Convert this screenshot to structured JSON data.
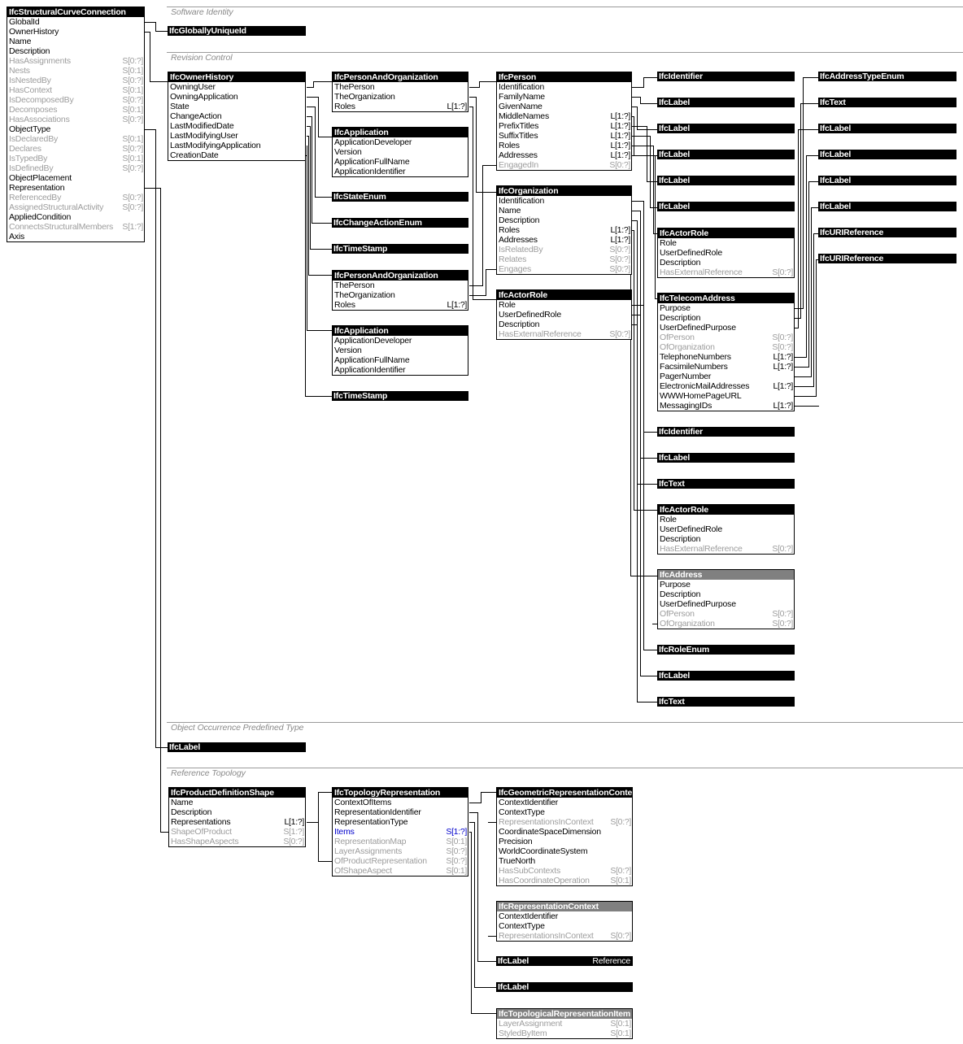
{
  "diagram": {
    "title": "IfcStructuralCurveConnection entity attribute diagram",
    "colors": {
      "header_concrete": "#000000",
      "header_abstract": "#808080",
      "inverse_attribute": "#9d9d9d",
      "highlight": "#0000cc",
      "separator": "#9a9a9a"
    }
  },
  "sections": [
    {
      "label": "Software Identity"
    },
    {
      "label": "Revision Control"
    },
    {
      "label": "Object Occurrence Predefined Type"
    },
    {
      "label": "Reference Topology"
    }
  ],
  "entities": {
    "root": {
      "name": "IfcStructuralCurveConnection",
      "abstract": false,
      "attributes": [
        {
          "name": "GlobalId",
          "card": "",
          "inverse": false
        },
        {
          "name": "OwnerHistory",
          "card": "",
          "inverse": false
        },
        {
          "name": "Name",
          "card": "",
          "inverse": false
        },
        {
          "name": "Description",
          "card": "",
          "inverse": false
        },
        {
          "name": "HasAssignments",
          "card": "S[0:?]",
          "inverse": true
        },
        {
          "name": "Nests",
          "card": "S[0:1]",
          "inverse": true
        },
        {
          "name": "IsNestedBy",
          "card": "S[0:?]",
          "inverse": true
        },
        {
          "name": "HasContext",
          "card": "S[0:1]",
          "inverse": true
        },
        {
          "name": "IsDecomposedBy",
          "card": "S[0:?]",
          "inverse": true
        },
        {
          "name": "Decomposes",
          "card": "S[0:1]",
          "inverse": true
        },
        {
          "name": "HasAssociations",
          "card": "S[0:?]",
          "inverse": true
        },
        {
          "name": "ObjectType",
          "card": "",
          "inverse": false
        },
        {
          "name": "IsDeclaredBy",
          "card": "S[0:1]",
          "inverse": true
        },
        {
          "name": "Declares",
          "card": "S[0:?]",
          "inverse": true
        },
        {
          "name": "IsTypedBy",
          "card": "S[0:1]",
          "inverse": true
        },
        {
          "name": "IsDefinedBy",
          "card": "S[0:?]",
          "inverse": true
        },
        {
          "name": "ObjectPlacement",
          "card": "",
          "inverse": false
        },
        {
          "name": "Representation",
          "card": "",
          "inverse": false
        },
        {
          "name": "ReferencedBy",
          "card": "S[0:?]",
          "inverse": true
        },
        {
          "name": "AssignedStructuralActivity",
          "card": "S[0:?]",
          "inverse": true
        },
        {
          "name": "AppliedCondition",
          "card": "",
          "inverse": false
        },
        {
          "name": "ConnectsStructuralMembers",
          "card": "S[1:?]",
          "inverse": true
        },
        {
          "name": "Axis",
          "card": "",
          "inverse": false
        }
      ]
    },
    "owner_history": {
      "name": "IfcOwnerHistory",
      "abstract": false,
      "attributes": [
        {
          "name": "OwningUser",
          "card": "",
          "inverse": false
        },
        {
          "name": "OwningApplication",
          "card": "",
          "inverse": false
        },
        {
          "name": "State",
          "card": "",
          "inverse": false
        },
        {
          "name": "ChangeAction",
          "card": "",
          "inverse": false
        },
        {
          "name": "LastModifiedDate",
          "card": "",
          "inverse": false
        },
        {
          "name": "LastModifyingUser",
          "card": "",
          "inverse": false
        },
        {
          "name": "LastModifyingApplication",
          "card": "",
          "inverse": false
        },
        {
          "name": "CreationDate",
          "card": "",
          "inverse": false
        }
      ]
    },
    "person_and_org_1": {
      "name": "IfcPersonAndOrganization",
      "abstract": false,
      "attributes": [
        {
          "name": "ThePerson",
          "card": "",
          "inverse": false
        },
        {
          "name": "TheOrganization",
          "card": "",
          "inverse": false
        },
        {
          "name": "Roles",
          "card": "L[1:?]",
          "inverse": false
        }
      ]
    },
    "application_1": {
      "name": "IfcApplication",
      "abstract": false,
      "attributes": [
        {
          "name": "ApplicationDeveloper",
          "card": "",
          "inverse": false
        },
        {
          "name": "Version",
          "card": "",
          "inverse": false
        },
        {
          "name": "ApplicationFullName",
          "card": "",
          "inverse": false
        },
        {
          "name": "ApplicationIdentifier",
          "card": "",
          "inverse": false
        }
      ]
    },
    "person_and_org_2": {
      "name": "IfcPersonAndOrganization",
      "abstract": false,
      "attributes": [
        {
          "name": "ThePerson",
          "card": "",
          "inverse": false
        },
        {
          "name": "TheOrganization",
          "card": "",
          "inverse": false
        },
        {
          "name": "Roles",
          "card": "L[1:?]",
          "inverse": false
        }
      ]
    },
    "application_2": {
      "name": "IfcApplication",
      "abstract": false,
      "attributes": [
        {
          "name": "ApplicationDeveloper",
          "card": "",
          "inverse": false
        },
        {
          "name": "Version",
          "card": "",
          "inverse": false
        },
        {
          "name": "ApplicationFullName",
          "card": "",
          "inverse": false
        },
        {
          "name": "ApplicationIdentifier",
          "card": "",
          "inverse": false
        }
      ]
    },
    "person": {
      "name": "IfcPerson",
      "abstract": false,
      "attributes": [
        {
          "name": "Identification",
          "card": "",
          "inverse": false
        },
        {
          "name": "FamilyName",
          "card": "",
          "inverse": false
        },
        {
          "name": "GivenName",
          "card": "",
          "inverse": false
        },
        {
          "name": "MiddleNames",
          "card": "L[1:?]",
          "inverse": false
        },
        {
          "name": "PrefixTitles",
          "card": "L[1:?]",
          "inverse": false
        },
        {
          "name": "SuffixTitles",
          "card": "L[1:?]",
          "inverse": false
        },
        {
          "name": "Roles",
          "card": "L[1:?]",
          "inverse": false
        },
        {
          "name": "Addresses",
          "card": "L[1:?]",
          "inverse": false
        },
        {
          "name": "EngagedIn",
          "card": "S[0:?]",
          "inverse": true
        }
      ]
    },
    "organization": {
      "name": "IfcOrganization",
      "abstract": false,
      "attributes": [
        {
          "name": "Identification",
          "card": "",
          "inverse": false
        },
        {
          "name": "Name",
          "card": "",
          "inverse": false
        },
        {
          "name": "Description",
          "card": "",
          "inverse": false
        },
        {
          "name": "Roles",
          "card": "L[1:?]",
          "inverse": false
        },
        {
          "name": "Addresses",
          "card": "L[1:?]",
          "inverse": false
        },
        {
          "name": "IsRelatedBy",
          "card": "S[0:?]",
          "inverse": true
        },
        {
          "name": "Relates",
          "card": "S[0:?]",
          "inverse": true
        },
        {
          "name": "Engages",
          "card": "S[0:?]",
          "inverse": true
        }
      ]
    },
    "actor_role_mid": {
      "name": "IfcActorRole",
      "abstract": false,
      "attributes": [
        {
          "name": "Role",
          "card": "",
          "inverse": false
        },
        {
          "name": "UserDefinedRole",
          "card": "",
          "inverse": false
        },
        {
          "name": "Description",
          "card": "",
          "inverse": false
        },
        {
          "name": "HasExternalReference",
          "card": "S[0:?]",
          "inverse": true
        }
      ]
    },
    "actor_role_r1": {
      "name": "IfcActorRole",
      "abstract": false,
      "attributes": [
        {
          "name": "Role",
          "card": "",
          "inverse": false
        },
        {
          "name": "UserDefinedRole",
          "card": "",
          "inverse": false
        },
        {
          "name": "Description",
          "card": "",
          "inverse": false
        },
        {
          "name": "HasExternalReference",
          "card": "S[0:?]",
          "inverse": true
        }
      ]
    },
    "telecom_address": {
      "name": "IfcTelecomAddress",
      "abstract": false,
      "attributes": [
        {
          "name": "Purpose",
          "card": "",
          "inverse": false
        },
        {
          "name": "Description",
          "card": "",
          "inverse": false
        },
        {
          "name": "UserDefinedPurpose",
          "card": "",
          "inverse": false
        },
        {
          "name": "OfPerson",
          "card": "S[0:?]",
          "inverse": true
        },
        {
          "name": "OfOrganization",
          "card": "S[0:?]",
          "inverse": true
        },
        {
          "name": "TelephoneNumbers",
          "card": "L[1:?]",
          "inverse": false
        },
        {
          "name": "FacsimileNumbers",
          "card": "L[1:?]",
          "inverse": false
        },
        {
          "name": "PagerNumber",
          "card": "",
          "inverse": false
        },
        {
          "name": "ElectronicMailAddresses",
          "card": "L[1:?]",
          "inverse": false
        },
        {
          "name": "WWWHomePageURL",
          "card": "",
          "inverse": false
        },
        {
          "name": "MessagingIDs",
          "card": "L[1:?]",
          "inverse": false
        }
      ]
    },
    "actor_role_r2": {
      "name": "IfcActorRole",
      "abstract": false,
      "attributes": [
        {
          "name": "Role",
          "card": "",
          "inverse": false
        },
        {
          "name": "UserDefinedRole",
          "card": "",
          "inverse": false
        },
        {
          "name": "Description",
          "card": "",
          "inverse": false
        },
        {
          "name": "HasExternalReference",
          "card": "S[0:?]",
          "inverse": true
        }
      ]
    },
    "address": {
      "name": "IfcAddress",
      "abstract": true,
      "attributes": [
        {
          "name": "Purpose",
          "card": "",
          "inverse": false
        },
        {
          "name": "Description",
          "card": "",
          "inverse": false
        },
        {
          "name": "UserDefinedPurpose",
          "card": "",
          "inverse": false
        },
        {
          "name": "OfPerson",
          "card": "S[0:?]",
          "inverse": true
        },
        {
          "name": "OfOrganization",
          "card": "S[0:?]",
          "inverse": true
        }
      ]
    },
    "product_definition_shape": {
      "name": "IfcProductDefinitionShape",
      "abstract": false,
      "attributes": [
        {
          "name": "Name",
          "card": "",
          "inverse": false
        },
        {
          "name": "Description",
          "card": "",
          "inverse": false
        },
        {
          "name": "Representations",
          "card": "L[1:?]",
          "inverse": false
        },
        {
          "name": "ShapeOfProduct",
          "card": "S[1:?]",
          "inverse": true
        },
        {
          "name": "HasShapeAspects",
          "card": "S[0:?]",
          "inverse": true
        }
      ]
    },
    "topology_representation": {
      "name": "IfcTopologyRepresentation",
      "abstract": false,
      "attributes": [
        {
          "name": "ContextOfItems",
          "card": "",
          "inverse": false
        },
        {
          "name": "RepresentationIdentifier",
          "card": "",
          "inverse": false
        },
        {
          "name": "RepresentationType",
          "card": "",
          "inverse": false
        },
        {
          "name": "Items",
          "card": "S[1:?]",
          "inverse": false,
          "highlight": true
        },
        {
          "name": "RepresentationMap",
          "card": "S[0:1]",
          "inverse": true
        },
        {
          "name": "LayerAssignments",
          "card": "S[0:?]",
          "inverse": true
        },
        {
          "name": "OfProductRepresentation",
          "card": "S[0:?]",
          "inverse": true
        },
        {
          "name": "OfShapeAspect",
          "card": "S[0:1]",
          "inverse": true
        }
      ]
    },
    "geometric_representation_context": {
      "name": "IfcGeometricRepresentationContext",
      "abstract": false,
      "attributes": [
        {
          "name": "ContextIdentifier",
          "card": "",
          "inverse": false
        },
        {
          "name": "ContextType",
          "card": "",
          "inverse": false
        },
        {
          "name": "RepresentationsInContext",
          "card": "S[0:?]",
          "inverse": true
        },
        {
          "name": "CoordinateSpaceDimension",
          "card": "",
          "inverse": false
        },
        {
          "name": "Precision",
          "card": "",
          "inverse": false
        },
        {
          "name": "WorldCoordinateSystem",
          "card": "",
          "inverse": false
        },
        {
          "name": "TrueNorth",
          "card": "",
          "inverse": false
        },
        {
          "name": "HasSubContexts",
          "card": "S[0:?]",
          "inverse": true
        },
        {
          "name": "HasCoordinateOperation",
          "card": "S[0:1]",
          "inverse": true
        }
      ]
    },
    "representation_context": {
      "name": "IfcRepresentationContext",
      "abstract": true,
      "attributes": [
        {
          "name": "ContextIdentifier",
          "card": "",
          "inverse": false
        },
        {
          "name": "ContextType",
          "card": "",
          "inverse": false
        },
        {
          "name": "RepresentationsInContext",
          "card": "S[0:?]",
          "inverse": true
        }
      ]
    },
    "topological_representation_item": {
      "name": "IfcTopologicalRepresentationItem",
      "abstract": true,
      "attributes": [
        {
          "name": "LayerAssignment",
          "card": "S[0:1]",
          "inverse": true
        },
        {
          "name": "StyledByItem",
          "card": "S[0:1]",
          "inverse": true
        }
      ]
    }
  },
  "type_bars": {
    "globally_unique_id": {
      "name": "IfcGloballyUniqueId",
      "value": ""
    },
    "state_enum": {
      "name": "IfcStateEnum",
      "value": ""
    },
    "change_action_enum": {
      "name": "IfcChangeActionEnum",
      "value": ""
    },
    "time_stamp_1": {
      "name": "IfcTimeStamp",
      "value": ""
    },
    "time_stamp_2": {
      "name": "IfcTimeStamp",
      "value": ""
    },
    "identifier_c3_1": {
      "name": "IfcIdentifier",
      "value": ""
    },
    "label_c3_1": {
      "name": "IfcLabel",
      "value": ""
    },
    "label_c3_2": {
      "name": "IfcLabel",
      "value": ""
    },
    "label_c3_3": {
      "name": "IfcLabel",
      "value": ""
    },
    "label_c3_4": {
      "name": "IfcLabel",
      "value": ""
    },
    "label_c3_5": {
      "name": "IfcLabel",
      "value": ""
    },
    "identifier_c3_2": {
      "name": "IfcIdentifier",
      "value": ""
    },
    "label_c3_6": {
      "name": "IfcLabel",
      "value": ""
    },
    "text_c3_1": {
      "name": "IfcText",
      "value": ""
    },
    "role_enum": {
      "name": "IfcRoleEnum",
      "value": ""
    },
    "label_c3_7": {
      "name": "IfcLabel",
      "value": ""
    },
    "text_c3_2": {
      "name": "IfcText",
      "value": ""
    },
    "address_type_enum": {
      "name": "IfcAddressTypeEnum",
      "value": ""
    },
    "text_c4_1": {
      "name": "IfcText",
      "value": ""
    },
    "label_c4_1": {
      "name": "IfcLabel",
      "value": ""
    },
    "label_c4_2": {
      "name": "IfcLabel",
      "value": ""
    },
    "label_c4_3": {
      "name": "IfcLabel",
      "value": ""
    },
    "label_c4_4": {
      "name": "IfcLabel",
      "value": ""
    },
    "uri_reference_1": {
      "name": "IfcURIReference",
      "value": ""
    },
    "uri_reference_2": {
      "name": "IfcURIReference",
      "value": ""
    },
    "predefined_type_label": {
      "name": "IfcLabel",
      "value": ""
    },
    "label_reference": {
      "name": "IfcLabel",
      "value": "Reference"
    },
    "label_rep_type": {
      "name": "IfcLabel",
      "value": ""
    }
  }
}
